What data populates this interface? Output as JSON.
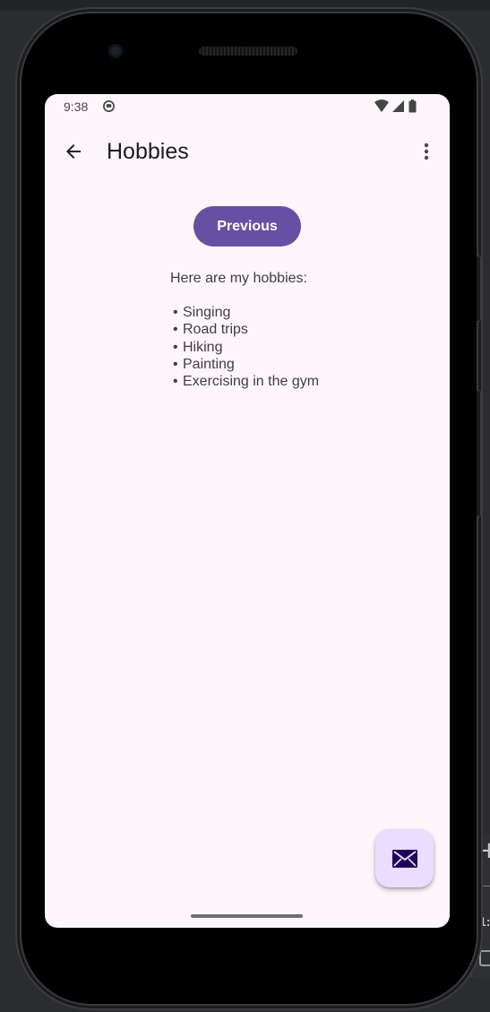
{
  "status_bar": {
    "time": "9:38",
    "app_icon": "notification-app-icon",
    "icons": [
      "wifi-icon",
      "cellular-signal-icon",
      "battery-icon"
    ]
  },
  "top_bar": {
    "back_icon": "arrow-back-icon",
    "title": "Hobbies",
    "more_icon": "more-vert-icon"
  },
  "content": {
    "previous_label": "Previous",
    "intro": "Here are my hobbies:",
    "hobbies": [
      "Singing",
      "Road trips",
      "Hiking",
      "Painting",
      "Exercising in the gym"
    ],
    "bullet": "•"
  },
  "fab": {
    "icon": "mail-icon"
  },
  "emulator_panel": {
    "plus": "+",
    "ratio": "1:"
  },
  "colors": {
    "primary": "#6750a4",
    "background": "#fdf7fc",
    "fab_container": "#eaddff",
    "on_fab": "#21005d"
  }
}
